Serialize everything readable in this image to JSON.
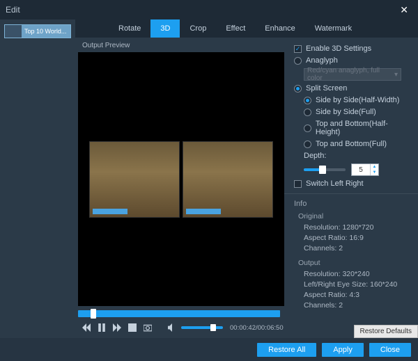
{
  "title": "Edit",
  "sidebar": {
    "thumb_label": "Top 10 World..."
  },
  "tabs": [
    "Rotate",
    "3D",
    "Crop",
    "Effect",
    "Enhance",
    "Watermark"
  ],
  "active_tab_index": 1,
  "preview": {
    "label": "Output Preview",
    "time_current": "00:00:42",
    "time_total": "00:06:50"
  },
  "settings": {
    "enable_label": "Enable 3D Settings",
    "enable_checked": true,
    "anaglyph_label": "Anaglyph",
    "anaglyph_selected": false,
    "anaglyph_option": "Red/cyan anaglyph, full color",
    "split_label": "Split Screen",
    "split_selected": true,
    "modes": [
      {
        "label": "Side by Side(Half-Width)",
        "selected": true
      },
      {
        "label": "Side by Side(Full)",
        "selected": false
      },
      {
        "label": "Top and Bottom(Half-Height)",
        "selected": false
      },
      {
        "label": "Top and Bottom(Full)",
        "selected": false
      }
    ],
    "depth_label": "Depth:",
    "depth_value": "5",
    "switch_label": "Switch Left Right",
    "switch_checked": false
  },
  "info": {
    "header": "Info",
    "original": {
      "title": "Original",
      "resolution_label": "Resolution:",
      "resolution": "1280*720",
      "aspect_label": "Aspect Ratio:",
      "aspect": "16:9",
      "channels_label": "Channels:",
      "channels": "2"
    },
    "output": {
      "title": "Output",
      "resolution_label": "Resolution:",
      "resolution": "320*240",
      "eye_label": "Left/Right Eye Size:",
      "eye": "160*240",
      "aspect_label": "Aspect Ratio:",
      "aspect": "4:3",
      "channels_label": "Channels:",
      "channels": "2"
    }
  },
  "buttons": {
    "restore_defaults": "Restore Defaults",
    "restore_all": "Restore All",
    "apply": "Apply",
    "close": "Close"
  }
}
